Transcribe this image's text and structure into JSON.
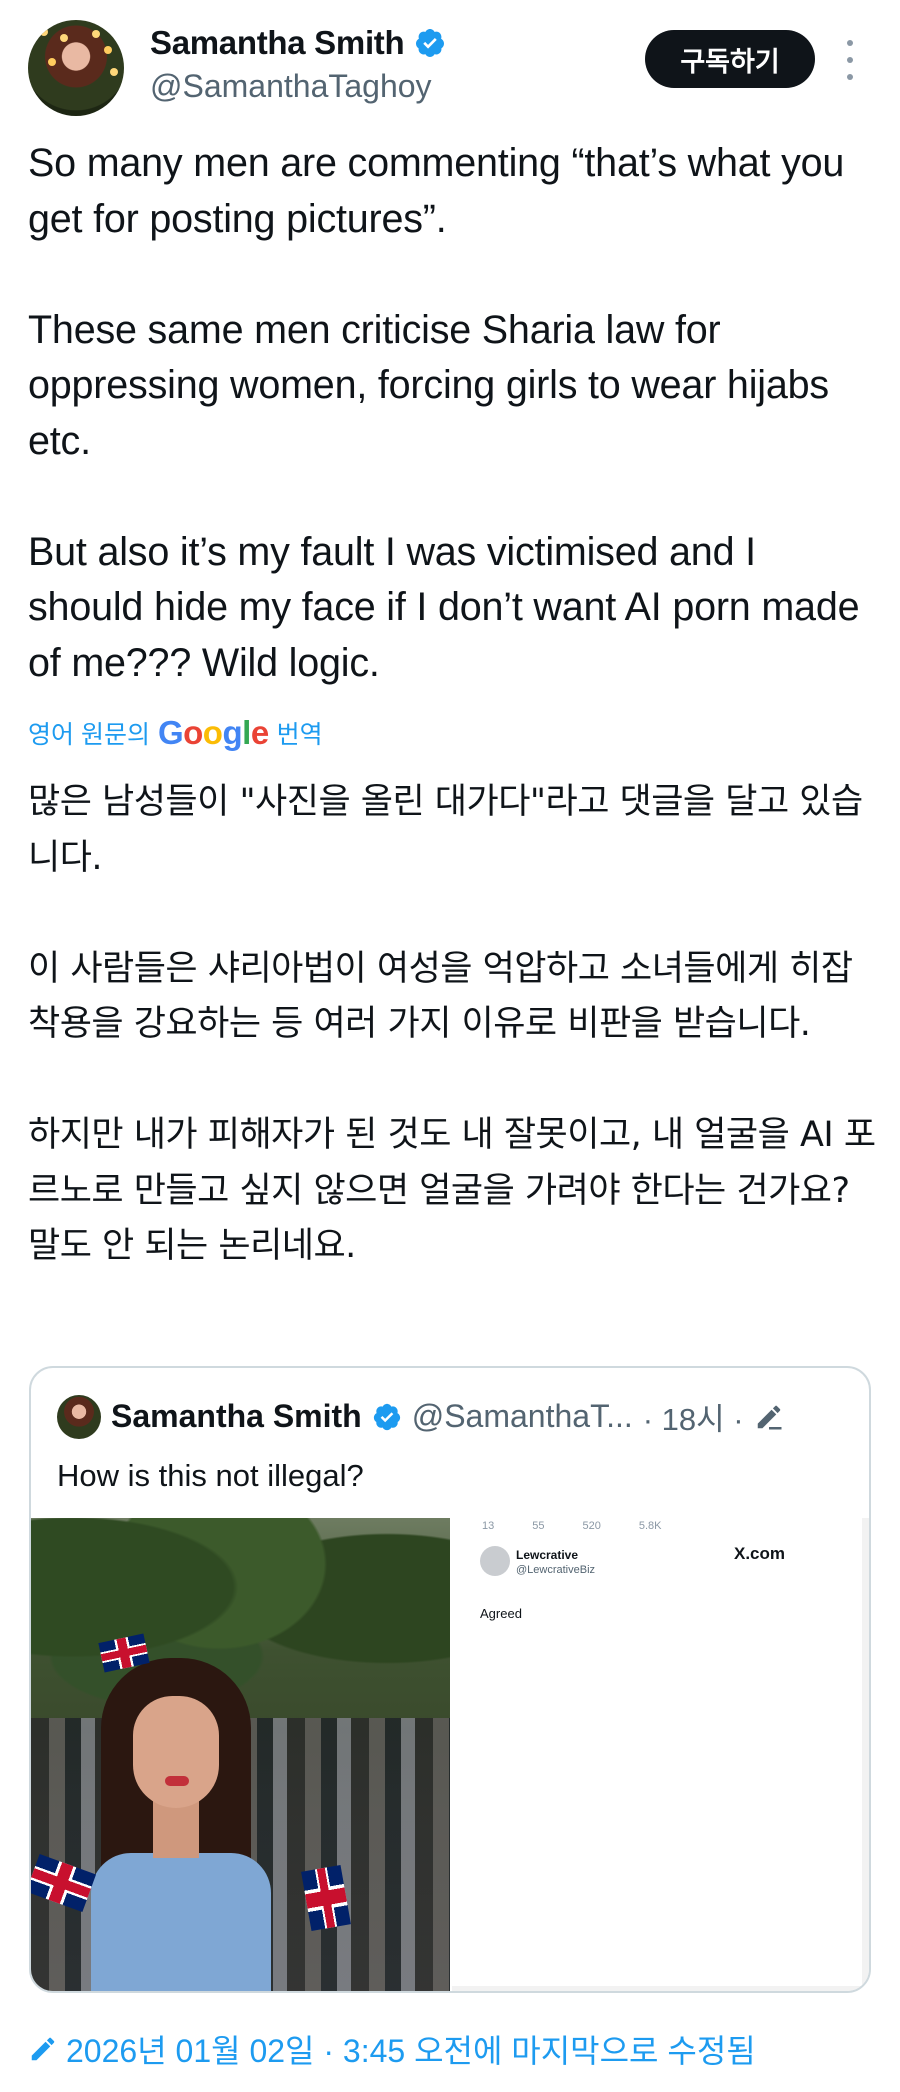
{
  "author": {
    "name": "Samantha Smith",
    "handle": "@SamanthaTaghoy",
    "subscribe_label": "구독하기"
  },
  "tweet": {
    "paragraphs": [
      "So many men are commenting “that’s what you get for posting pictures”.",
      "These same men criticise Sharia law for oppressing women, forcing girls to wear hijabs etc.",
      "But also it’s my fault I was victimised and I should hide my face if I don’t want AI porn made of me??? Wild logic."
    ]
  },
  "translation": {
    "prefix": "영어 원문의",
    "brand": [
      "G",
      "o",
      "o",
      "g",
      "l",
      "e"
    ],
    "suffix": "번역",
    "paragraphs": [
      "많은 남성들이 \"사진을 올린 대가다\"라고 댓글을 달고 있습니다.",
      "이 사람들은 샤리아법이 여성을 억압하고 소녀들에게 히잡 착용을 강요하는 등 여러 가지 이유로 비판을 받습니다.",
      "하지만 내가 피해자가 된 것도 내 잘못이고, 내 얼굴을 AI 포르노로 만들고 싶지 않으면 얼굴을 가려야 한다는 건가요? 말도 안 되는 논리네요."
    ]
  },
  "quoted": {
    "name": "Samantha Smith",
    "handle": "@SamanthaT...",
    "time": "· 18시 ·",
    "text": "How is this not illegal?",
    "screenshot": {
      "user": "Lewcrative",
      "handle": "@LewcrativeBiz",
      "brand": "X.com",
      "reply": "Agreed",
      "stats": [
        "13",
        "55",
        "520",
        "5.8K"
      ]
    }
  },
  "footer": {
    "edited_label": "2026년 01월 02일 · 3:45 오전에 마지막으로 수정됨"
  },
  "colors": {
    "accent": "#1d9bf0",
    "text": "#0f1419",
    "muted": "#536471",
    "border": "#cfd9de"
  }
}
